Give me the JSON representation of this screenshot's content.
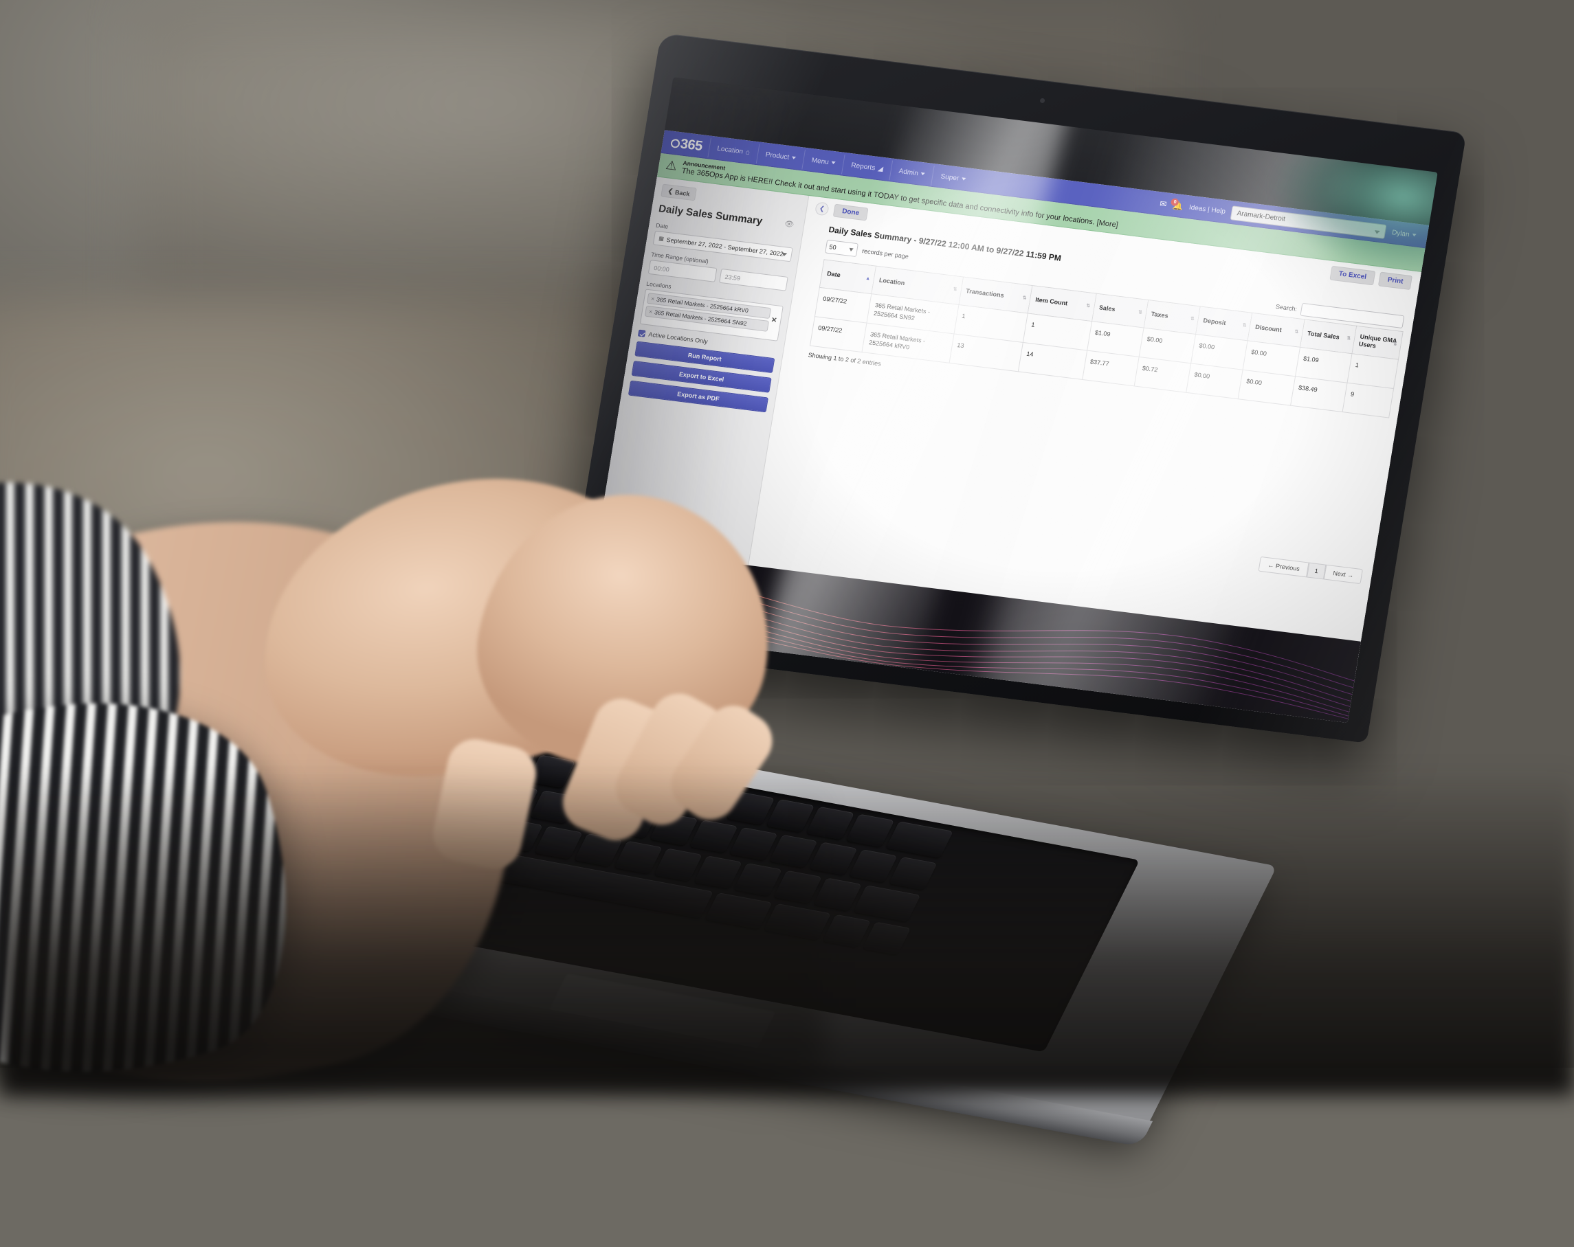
{
  "navbar": {
    "brand": "365",
    "items": [
      {
        "label": "Location",
        "icon": "home-icon",
        "has_caret": false
      },
      {
        "label": "Product",
        "icon": "",
        "has_caret": true
      },
      {
        "label": "Menu",
        "icon": "",
        "has_caret": true
      },
      {
        "label": "Reports",
        "icon": "bar-chart-icon",
        "has_caret": false
      },
      {
        "label": "Admin",
        "icon": "",
        "has_caret": true
      },
      {
        "label": "Super",
        "icon": "",
        "has_caret": true
      }
    ],
    "mail_icon": "envelope-icon",
    "bell_icon": "bell-icon",
    "bell_badge": "0",
    "ideas_help": "Ideas | Help",
    "location_select": "Aramark-Detroit",
    "user_menu": "Dylan"
  },
  "announcement": {
    "icon": "warning-triangle-icon",
    "title": "Announcement",
    "text": "The 365Ops App is HERE!! Check it out and start using it TODAY to get specific data and connectivity info for your locations. [More]"
  },
  "sidebar": {
    "back_label": "Back",
    "page_title": "Daily Sales Summary",
    "eye_icon": "eye-icon",
    "date_label": "Date",
    "date_value": "September 27, 2022 - September 27, 2022",
    "calendar_icon": "calendar-icon",
    "time_range_label": "Time Range (optional)",
    "time_start": "00:00",
    "time_end": "23:59",
    "locations_label": "Locations",
    "location_tags": [
      "365 Retail Markets - 2525664 kRV0",
      "365 Retail Markets - 2525664 SN92"
    ],
    "clear_all_icon": "clear-icon",
    "active_only_label": "Active Locations Only",
    "active_only_checked": true,
    "buttons": [
      "Run Report",
      "Export to Excel",
      "Export as PDF"
    ]
  },
  "main": {
    "collapse_icon": "chevron-left-icon",
    "done_label": "Done",
    "to_excel_label": "To Excel",
    "print_label": "Print",
    "report_title": "Daily Sales Summary - 9/27/22 12:00 AM to 9/27/22 11:59 PM",
    "records_per_page_value": "50",
    "records_per_page_label": "records per page",
    "search_label": "Search:",
    "search_value": "",
    "search_placeholder": "",
    "table": {
      "columns": [
        "Date",
        "Location",
        "Transactions",
        "Item Count",
        "Sales",
        "Taxes",
        "Deposit",
        "Discount",
        "Total Sales",
        "Unique GMA Users"
      ],
      "sorted_column_index": 0,
      "rows": [
        [
          "09/27/22",
          "365 Retail Markets - 2525664 SN92",
          "1",
          "1",
          "$1.09",
          "$0.00",
          "$0.00",
          "$0.00",
          "$1.09",
          "1"
        ],
        [
          "09/27/22",
          "365 Retail Markets - 2525664 kRV0",
          "13",
          "14",
          "$37.77",
          "$0.72",
          "$0.00",
          "$0.00",
          "$38.49",
          "9"
        ]
      ]
    },
    "showing_text": "Showing 1 to 2 of 2 entries",
    "pagination": {
      "previous": "← Previous",
      "pages": [
        "1"
      ],
      "next": "Next →"
    }
  },
  "colors": {
    "navbar_blue": "#5a62c0",
    "announcement_green": "#a8d3ae",
    "button_blue": "#5e66c6",
    "link_blue": "#4b52bb",
    "badge_red": "#d9534f"
  }
}
